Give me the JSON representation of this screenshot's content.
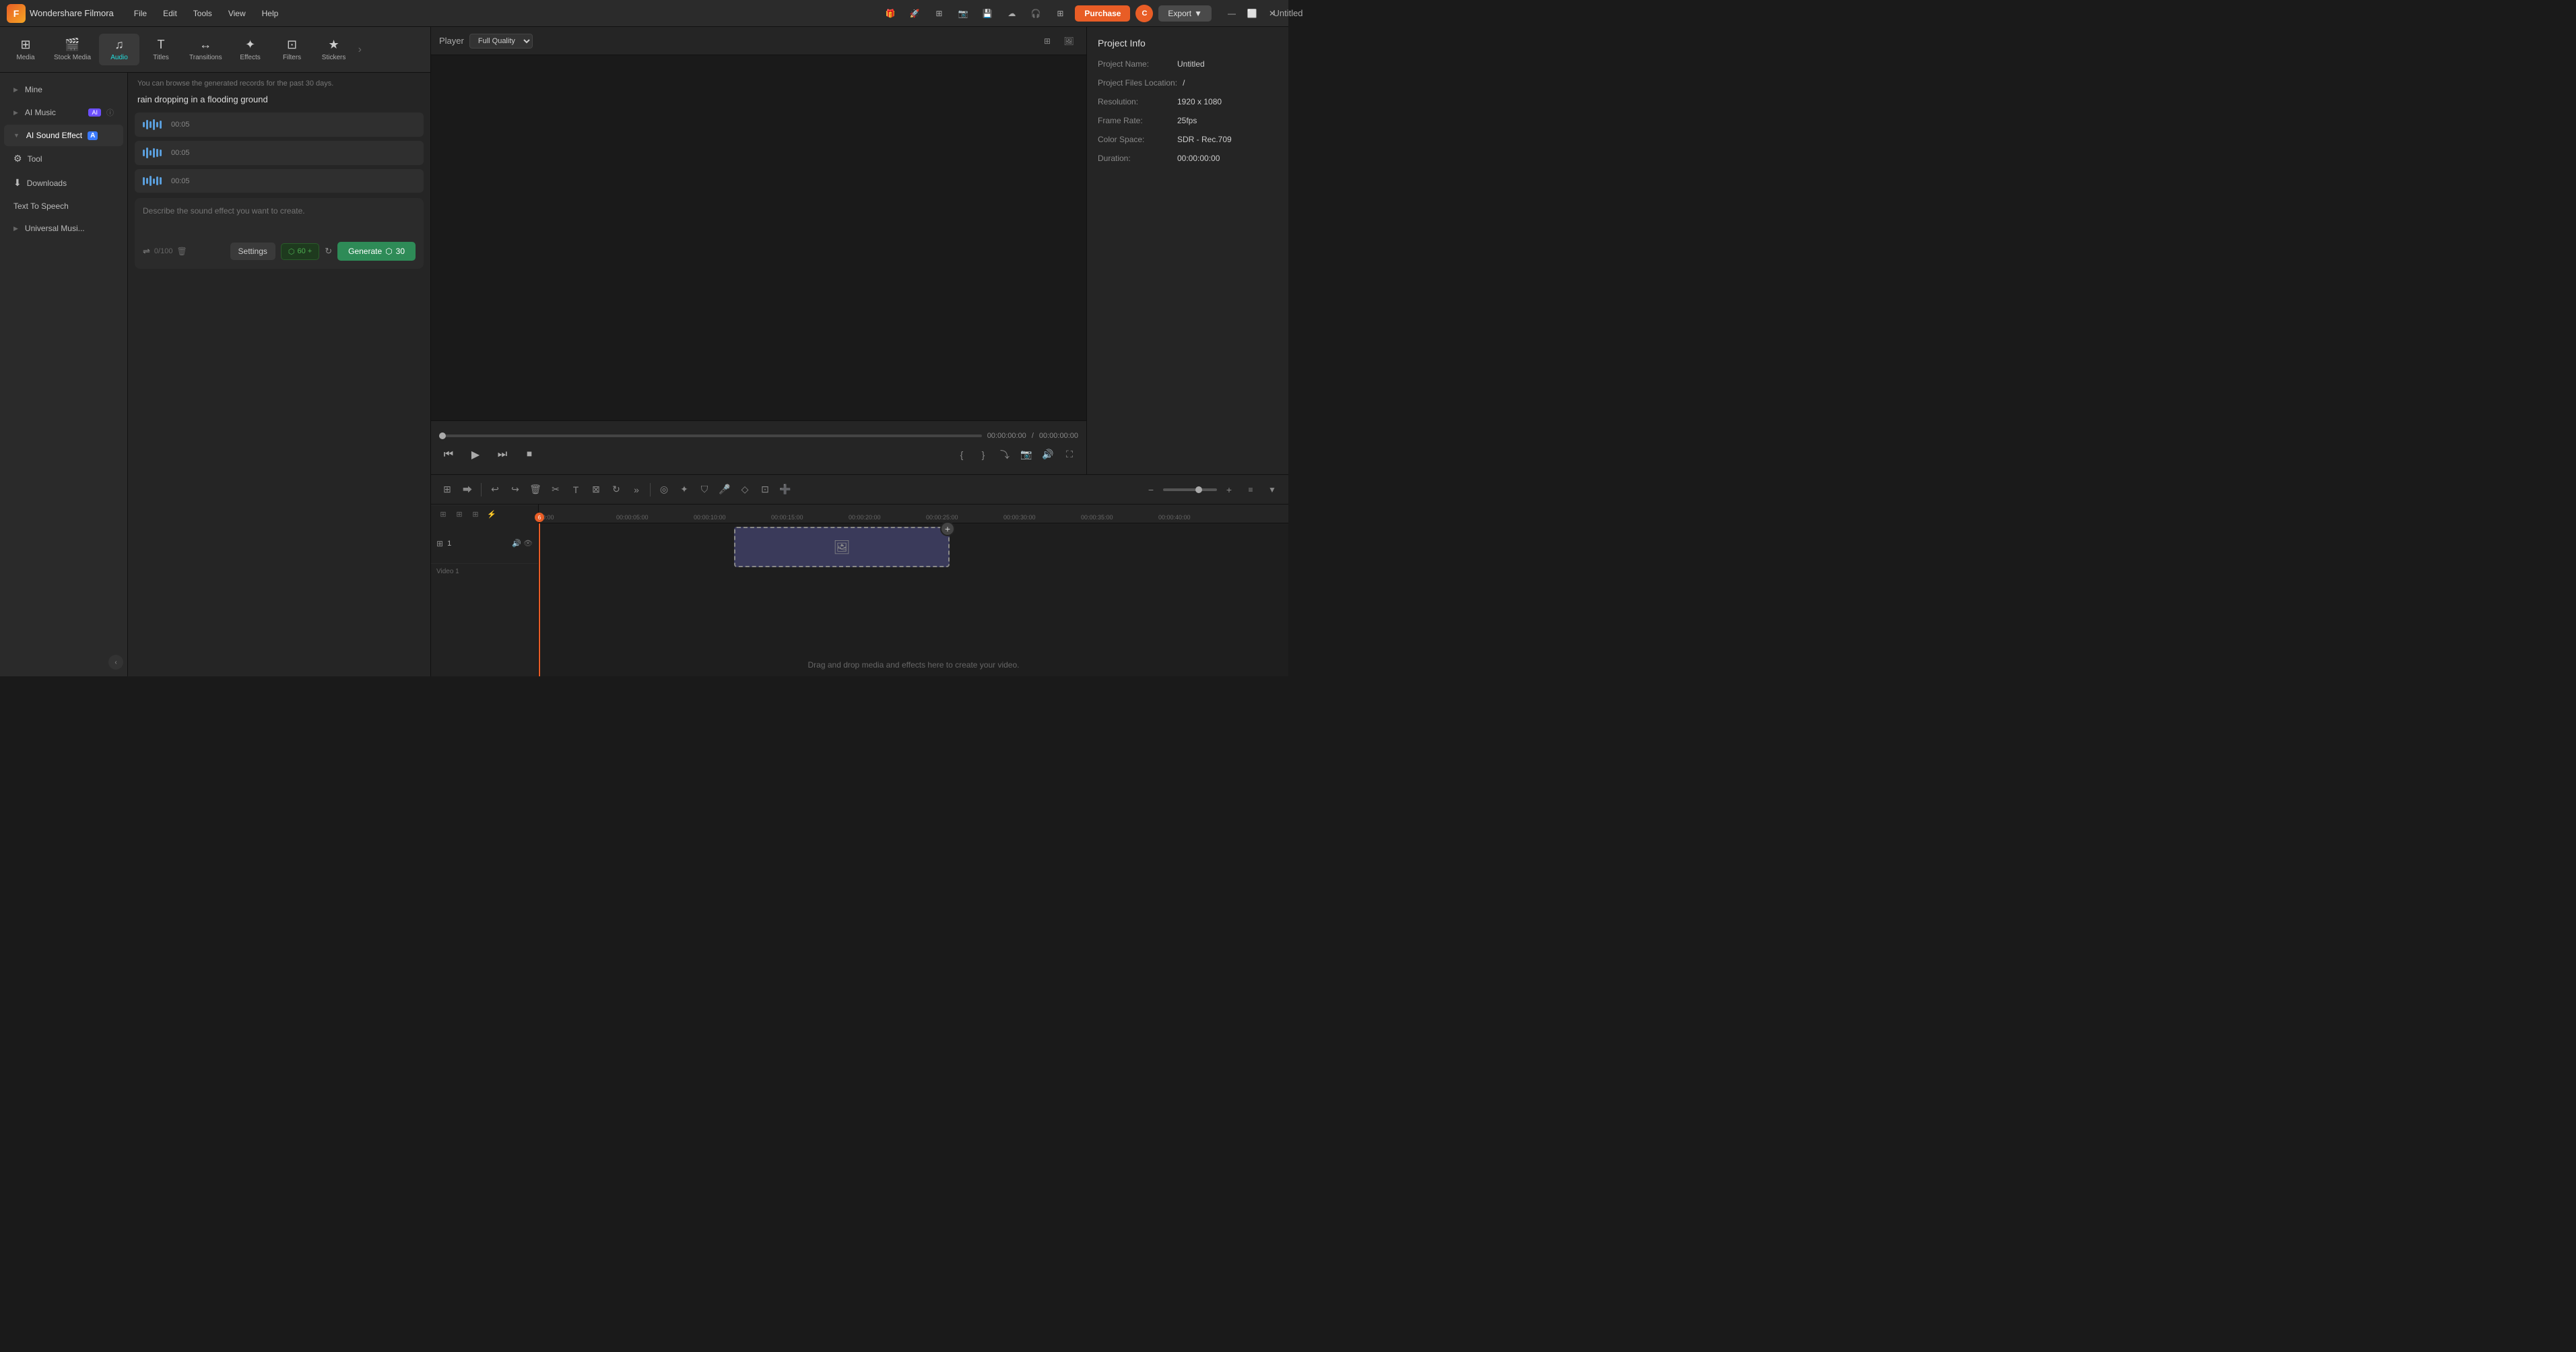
{
  "app": {
    "name": "Wondershare Filmora",
    "logo_letter": "F",
    "title": "Untitled"
  },
  "menu": {
    "items": [
      "File",
      "Edit",
      "Tools",
      "View",
      "Help"
    ]
  },
  "titlebar": {
    "purchase_label": "Purchase",
    "export_label": "Export",
    "user_initial": "C"
  },
  "toolbar": {
    "items": [
      {
        "id": "media",
        "label": "Media",
        "icon": "⊞"
      },
      {
        "id": "stock",
        "label": "Stock Media",
        "icon": "🎬"
      },
      {
        "id": "audio",
        "label": "Audio",
        "icon": "♫"
      },
      {
        "id": "titles",
        "label": "Titles",
        "icon": "T"
      },
      {
        "id": "transitions",
        "label": "Transitions",
        "icon": "↔"
      },
      {
        "id": "effects",
        "label": "Effects",
        "icon": "✦"
      },
      {
        "id": "filters",
        "label": "Filters",
        "icon": "⊡"
      },
      {
        "id": "stickers",
        "label": "Stickers",
        "icon": "★"
      }
    ],
    "active": "audio"
  },
  "sidebar": {
    "items": [
      {
        "id": "mine",
        "label": "Mine",
        "arrow": "▶",
        "active": false
      },
      {
        "id": "ai-music",
        "label": "AI Music",
        "arrow": "▶",
        "badge": "AI",
        "has_info": true,
        "active": false
      },
      {
        "id": "ai-sound-effect",
        "label": "AI Sound Effect",
        "arrow": "▼",
        "badge_a": "A",
        "active": true
      },
      {
        "id": "tool",
        "label": "Tool",
        "icon": "⚙",
        "active": false
      },
      {
        "id": "downloads",
        "label": "Downloads",
        "icon": "⬇",
        "active": false
      },
      {
        "id": "text-to-speech",
        "label": "Text To Speech",
        "active": false
      },
      {
        "id": "universal-music",
        "label": "Universal Musi...",
        "arrow": "▶",
        "active": false
      }
    ]
  },
  "ai_sound_effect": {
    "notice": "You can browse the generated records for the past 30 days.",
    "query": "rain dropping in a flooding ground",
    "audio_items": [
      {
        "duration": "00:05"
      },
      {
        "duration": "00:05"
      },
      {
        "duration": "00:05"
      }
    ],
    "textarea_placeholder": "Describe the sound effect you want to create.",
    "char_count": "0/100",
    "settings_label": "Settings",
    "credits": "60 +",
    "generate_label": "Generate",
    "generate_credits": "30"
  },
  "player": {
    "label": "Player",
    "quality": "Full Quality",
    "time_current": "00:00:00:00",
    "time_total": "00:00:00:00"
  },
  "project_info": {
    "title": "Project Info",
    "fields": [
      {
        "label": "Project Name:",
        "value": "Untitled"
      },
      {
        "label": "Project Files Location:",
        "value": "/"
      },
      {
        "label": "Resolution:",
        "value": "1920 x 1080"
      },
      {
        "label": "Frame Rate:",
        "value": "25fps"
      },
      {
        "label": "Color Space:",
        "value": "SDR - Rec.709"
      },
      {
        "label": "Duration:",
        "value": "00:00:00:00"
      }
    ]
  },
  "timeline": {
    "ruler_times": [
      "00:00",
      "00:00:05:00",
      "00:00:10:00",
      "00:00:15:00",
      "00:00:20:00",
      "00:00:25:00",
      "00:00:30:00",
      "00:00:35:00",
      "00:00:40:00"
    ],
    "drop_text": "Drag and drop media and effects here to create your video.",
    "track_label": "Video 1"
  }
}
